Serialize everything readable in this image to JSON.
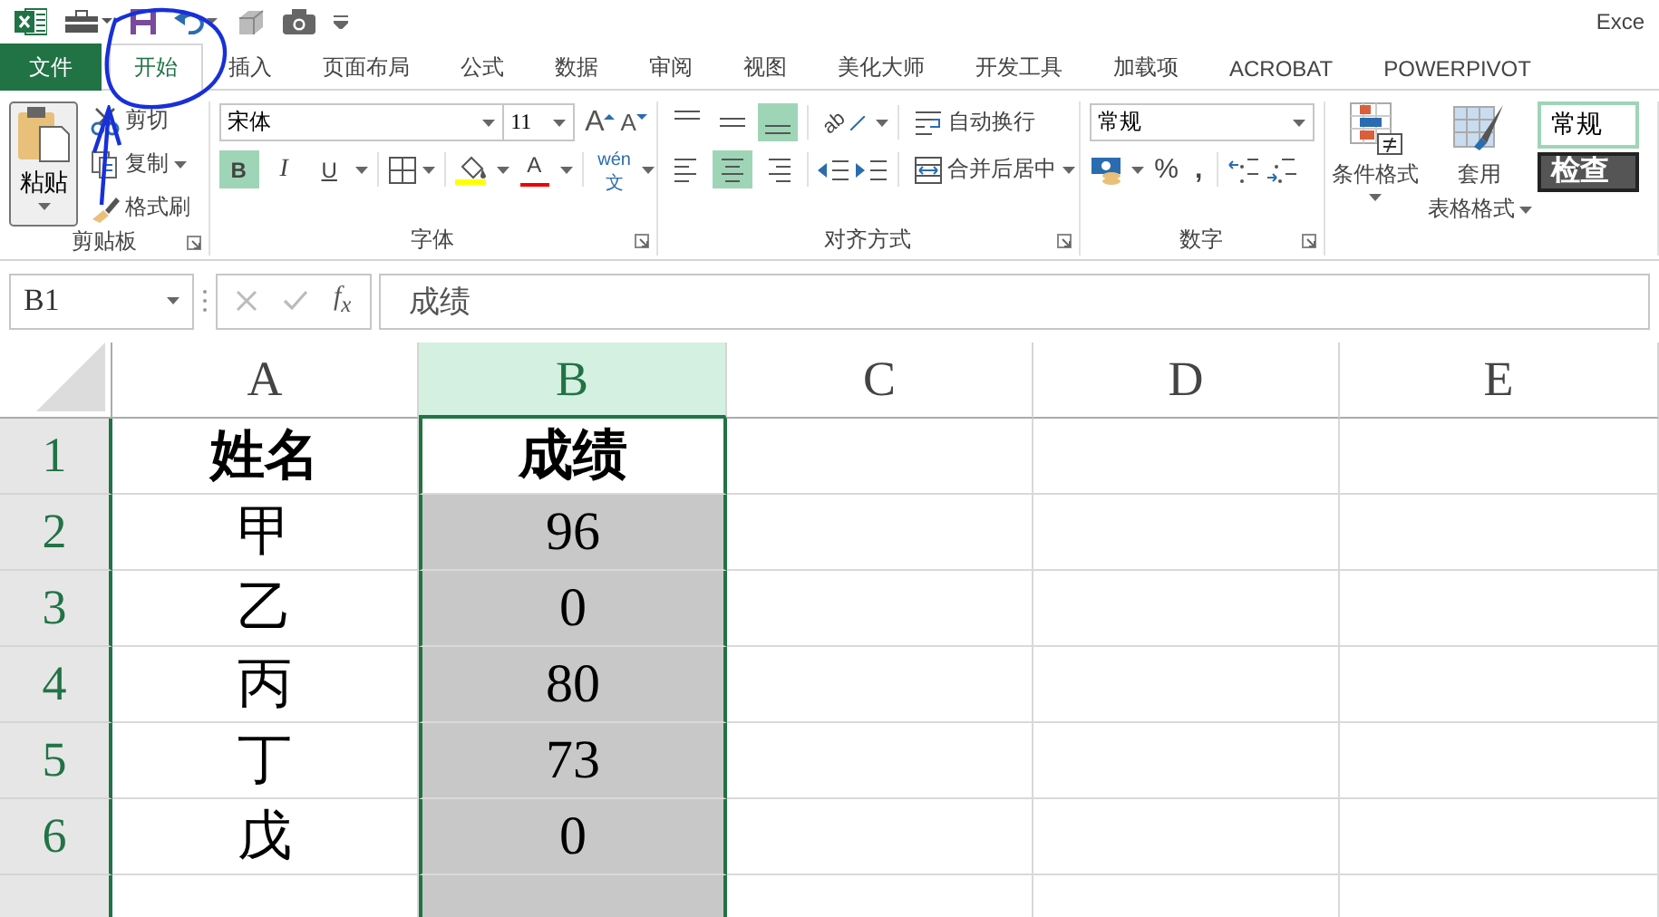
{
  "title_bar": {
    "title": "Exce"
  },
  "tabs": [
    {
      "label": "文件",
      "kind": "file",
      "selected": false
    },
    {
      "label": "开始",
      "kind": "tab",
      "selected": true
    },
    {
      "label": "插入",
      "kind": "tab",
      "selected": false
    },
    {
      "label": "页面布局",
      "kind": "tab",
      "selected": false
    },
    {
      "label": "公式",
      "kind": "tab",
      "selected": false
    },
    {
      "label": "数据",
      "kind": "tab",
      "selected": false
    },
    {
      "label": "审阅",
      "kind": "tab",
      "selected": false
    },
    {
      "label": "视图",
      "kind": "tab",
      "selected": false
    },
    {
      "label": "美化大师",
      "kind": "tab",
      "selected": false
    },
    {
      "label": "开发工具",
      "kind": "tab",
      "selected": false
    },
    {
      "label": "加载项",
      "kind": "tab",
      "selected": false
    },
    {
      "label": "ACROBAT",
      "kind": "tab",
      "selected": false
    },
    {
      "label": "POWERPIVOT",
      "kind": "tab",
      "selected": false
    }
  ],
  "ribbon": {
    "clipboard": {
      "paste": "粘贴",
      "cut": "剪切",
      "copy": "复制",
      "format_painter": "格式刷",
      "label": "剪贴板"
    },
    "font": {
      "font_name": "宋体",
      "font_size": "11",
      "grow_font": "A",
      "shrink_font": "A",
      "font_color": "A",
      "bold": {
        "label": "B",
        "on": true
      },
      "italic": {
        "label": "I",
        "on": false
      },
      "underline": {
        "label": "U",
        "on": false
      },
      "phonetic": {
        "pinyin": "wén",
        "char": "文"
      },
      "label": "字体"
    },
    "alignment": {
      "vertical": [
        {
          "kind": "top",
          "on": false
        },
        {
          "kind": "middle",
          "on": false
        },
        {
          "kind": "bottom",
          "on": true
        }
      ],
      "horizontal": [
        {
          "kind": "left",
          "on": false
        },
        {
          "kind": "center",
          "on": true
        },
        {
          "kind": "right",
          "on": false
        }
      ],
      "orientation": "ab",
      "wrap_text": "自动换行",
      "merge_center": "合并后居中",
      "label": "对齐方式"
    },
    "number": {
      "format": "常规",
      "percent": "%",
      "comma": ",",
      "label": "数字"
    },
    "styles": {
      "conditional_format": "条件格式",
      "format_as_table": "套用",
      "format_as_table_2": "表格格式",
      "cell_styles": [
        {
          "label": "常规",
          "kind": "normal"
        },
        {
          "label": "检查",
          "kind": "check"
        }
      ]
    }
  },
  "formula_bar": {
    "name_box": "B1",
    "fx": "f$_{x}$",
    "formula": "成绩"
  },
  "sheet": {
    "columns": [
      {
        "label": "A",
        "selected": false
      },
      {
        "label": "B",
        "selected": true
      },
      {
        "label": "C",
        "selected": false
      },
      {
        "label": "D",
        "selected": false
      },
      {
        "label": "E",
        "selected": false
      }
    ],
    "rows": [
      {
        "number": "1",
        "selected": true,
        "bold": true,
        "cells": [
          {
            "text": "姓名",
            "shaded": false
          },
          {
            "text": "成绩",
            "shaded": false
          }
        ]
      },
      {
        "number": "2",
        "selected": true,
        "bold": false,
        "cells": [
          {
            "text": "甲",
            "shaded": false
          },
          {
            "text": "96",
            "shaded": true
          }
        ]
      },
      {
        "number": "3",
        "selected": true,
        "bold": false,
        "cells": [
          {
            "text": "乙",
            "shaded": false
          },
          {
            "text": "0",
            "shaded": true
          }
        ]
      },
      {
        "number": "4",
        "selected": true,
        "bold": false,
        "cells": [
          {
            "text": "丙",
            "shaded": false
          },
          {
            "text": "80",
            "shaded": true
          }
        ]
      },
      {
        "number": "5",
        "selected": true,
        "bold": false,
        "cells": [
          {
            "text": "丁",
            "shaded": false
          },
          {
            "text": "73",
            "shaded": true
          }
        ]
      },
      {
        "number": "6",
        "selected": true,
        "bold": false,
        "cells": [
          {
            "text": "戊",
            "shaded": false
          },
          {
            "text": "0",
            "shaded": true
          }
        ]
      }
    ]
  }
}
